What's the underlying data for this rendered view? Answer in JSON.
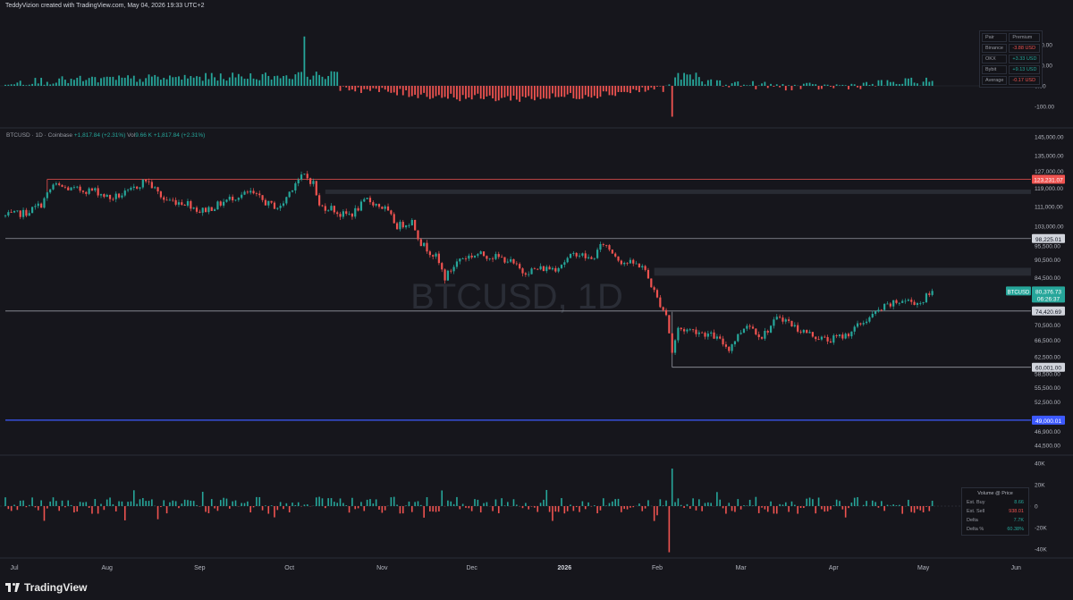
{
  "header": "TeddyVizion created with TradingView.com, May 04, 2026 19:33 UTC+2",
  "legend": {
    "symbol": "BTCUSD · 1D · Coinbase",
    "change": "+1,817.84 (+2.31%)",
    "vol_label": "Vol",
    "vol_value": "9.66 K",
    "vol_change": "+1,817.84 (+2.31%)"
  },
  "watermark": "BTCUSD, 1D",
  "brand": "TradingView",
  "premium_table": {
    "headers": [
      "Pair",
      "Premium"
    ],
    "rows": [
      [
        "Binance",
        "-3.88 USD"
      ],
      [
        "OKX",
        "+3.33 USD"
      ],
      [
        "Bybit",
        "+9.13 USD"
      ],
      [
        "Average",
        "-0.17 USD"
      ]
    ]
  },
  "volume_table": {
    "title": "Volume @ Price",
    "rows": [
      [
        "Est. Buy",
        "8.66"
      ],
      [
        "Est. Sell",
        "938.01"
      ],
      [
        "Delta",
        "7.7K"
      ],
      [
        "Delta %",
        "60.38%"
      ]
    ]
  },
  "colors": {
    "up": "#26a69a",
    "down": "#ef5350",
    "bg": "#16161c",
    "blue": "#3d5afe"
  },
  "chart_data": [
    {
      "type": "bar",
      "panel": "premium",
      "yticks": [
        "200.00",
        "100.00",
        "0.00",
        "-100.00"
      ],
      "ylim": [
        -150,
        250
      ]
    },
    {
      "type": "candlestick",
      "panel": "price",
      "xticks": [
        "Jul",
        "Aug",
        "Sep",
        "Oct",
        "Nov",
        "Dec",
        "2026",
        "Feb",
        "Mar",
        "Apr",
        "May",
        "Jun"
      ],
      "xdates": [
        "2025-07-01",
        "2025-08-01",
        "2025-09-01",
        "2025-10-01",
        "2025-11-01",
        "2025-12-01",
        "2026-01-01",
        "2026-02-01",
        "2026-03-01",
        "2026-04-01",
        "2026-05-01",
        "2026-06-01"
      ],
      "yticks": [
        "145,000.00",
        "135,000.00",
        "127,000.00",
        "119,000.00",
        "111,000.00",
        "103,000.00",
        "95,500.00",
        "90,500.00",
        "84,500.00",
        "80,376.73",
        "70,500.00",
        "66,500.00",
        "62,500.00",
        "58,500.00",
        "55,500.00",
        "52,500.00",
        "49,000.01",
        "46,900.00",
        "44,500.00"
      ],
      "key_levels": [
        {
          "label": "123,231.07",
          "value": 123231.07,
          "color": "#ef5350",
          "from": "2025-07-12"
        },
        {
          "label": "98,225.01",
          "value": 98225.01,
          "color": "#9598a1",
          "from": "2025-06-28"
        },
        {
          "label": "74,420.69",
          "value": 74420.69,
          "color": "#9598a1",
          "from": "2025-06-28"
        },
        {
          "label": "60,001.00",
          "value": 60001,
          "color": "#9598a1",
          "from": "2026-02-06"
        },
        {
          "label": "49,000.01",
          "value": 49000.01,
          "color": "#3d5afe",
          "from": "2025-06-28"
        }
      ],
      "zones": [
        {
          "from": "2025-10-13",
          "top": 118500,
          "bottom": 116500
        },
        {
          "from": "2026-01-31",
          "top": 87800,
          "bottom": 85200
        }
      ],
      "last_price": {
        "label": "BTCUSD",
        "value": "80,376.73",
        "countdown": "06:26:37"
      },
      "path": [
        [
          "2025-06-28",
          107000
        ],
        [
          "2025-07-05",
          108500
        ],
        [
          "2025-07-10",
          112000
        ],
        [
          "2025-07-14",
          120500
        ],
        [
          "2025-07-20",
          118500
        ],
        [
          "2025-07-28",
          118000
        ],
        [
          "2025-08-02",
          114500
        ],
        [
          "2025-08-08",
          117000
        ],
        [
          "2025-08-14",
          123000
        ],
        [
          "2025-08-20",
          114000
        ],
        [
          "2025-08-28",
          112500
        ],
        [
          "2025-09-01",
          109000
        ],
        [
          "2025-09-06",
          111000
        ],
        [
          "2025-09-12",
          115000
        ],
        [
          "2025-09-18",
          117000
        ],
        [
          "2025-09-24",
          112000
        ],
        [
          "2025-09-28",
          110500
        ],
        [
          "2025-10-03",
          122000
        ],
        [
          "2025-10-06",
          125000
        ],
        [
          "2025-10-09",
          121500
        ],
        [
          "2025-10-11",
          111000
        ],
        [
          "2025-10-15",
          110500
        ],
        [
          "2025-10-18",
          107500
        ],
        [
          "2025-10-22",
          108000
        ],
        [
          "2025-10-27",
          114000
        ],
        [
          "2025-11-02",
          110000
        ],
        [
          "2025-11-06",
          103000
        ],
        [
          "2025-11-11",
          105000
        ],
        [
          "2025-11-14",
          96500
        ],
        [
          "2025-11-19",
          91500
        ],
        [
          "2025-11-22",
          84500
        ],
        [
          "2025-11-27",
          91000
        ],
        [
          "2025-12-03",
          92500
        ],
        [
          "2025-12-09",
          91500
        ],
        [
          "2025-12-13",
          90500
        ],
        [
          "2025-12-18",
          86500
        ],
        [
          "2025-12-24",
          87500
        ],
        [
          "2025-12-29",
          87800
        ],
        [
          "2026-01-05",
          93000
        ],
        [
          "2026-01-10",
          90500
        ],
        [
          "2026-01-14",
          96500
        ],
        [
          "2026-01-20",
          90000
        ],
        [
          "2026-01-27",
          88500
        ],
        [
          "2026-02-01",
          78000
        ],
        [
          "2026-02-04",
          73500
        ],
        [
          "2026-02-06",
          63500
        ],
        [
          "2026-02-08",
          69500
        ],
        [
          "2026-02-14",
          69000
        ],
        [
          "2026-02-20",
          67500
        ],
        [
          "2026-02-25",
          64500
        ],
        [
          "2026-03-03",
          71000
        ],
        [
          "2026-03-08",
          67500
        ],
        [
          "2026-03-14",
          73000
        ],
        [
          "2026-03-20",
          69500
        ],
        [
          "2026-03-26",
          67500
        ],
        [
          "2026-03-30",
          66500
        ],
        [
          "2026-04-05",
          67800
        ],
        [
          "2026-04-12",
          72000
        ],
        [
          "2026-04-18",
          75500
        ],
        [
          "2026-04-24",
          77500
        ],
        [
          "2026-04-30",
          76800
        ],
        [
          "2026-05-04",
          80376.73
        ]
      ]
    },
    {
      "type": "bar",
      "panel": "volume_delta",
      "yticks": [
        "40K",
        "20K",
        "0",
        "-20K",
        "-40K"
      ],
      "ylim": [
        -45000,
        45000
      ]
    }
  ]
}
